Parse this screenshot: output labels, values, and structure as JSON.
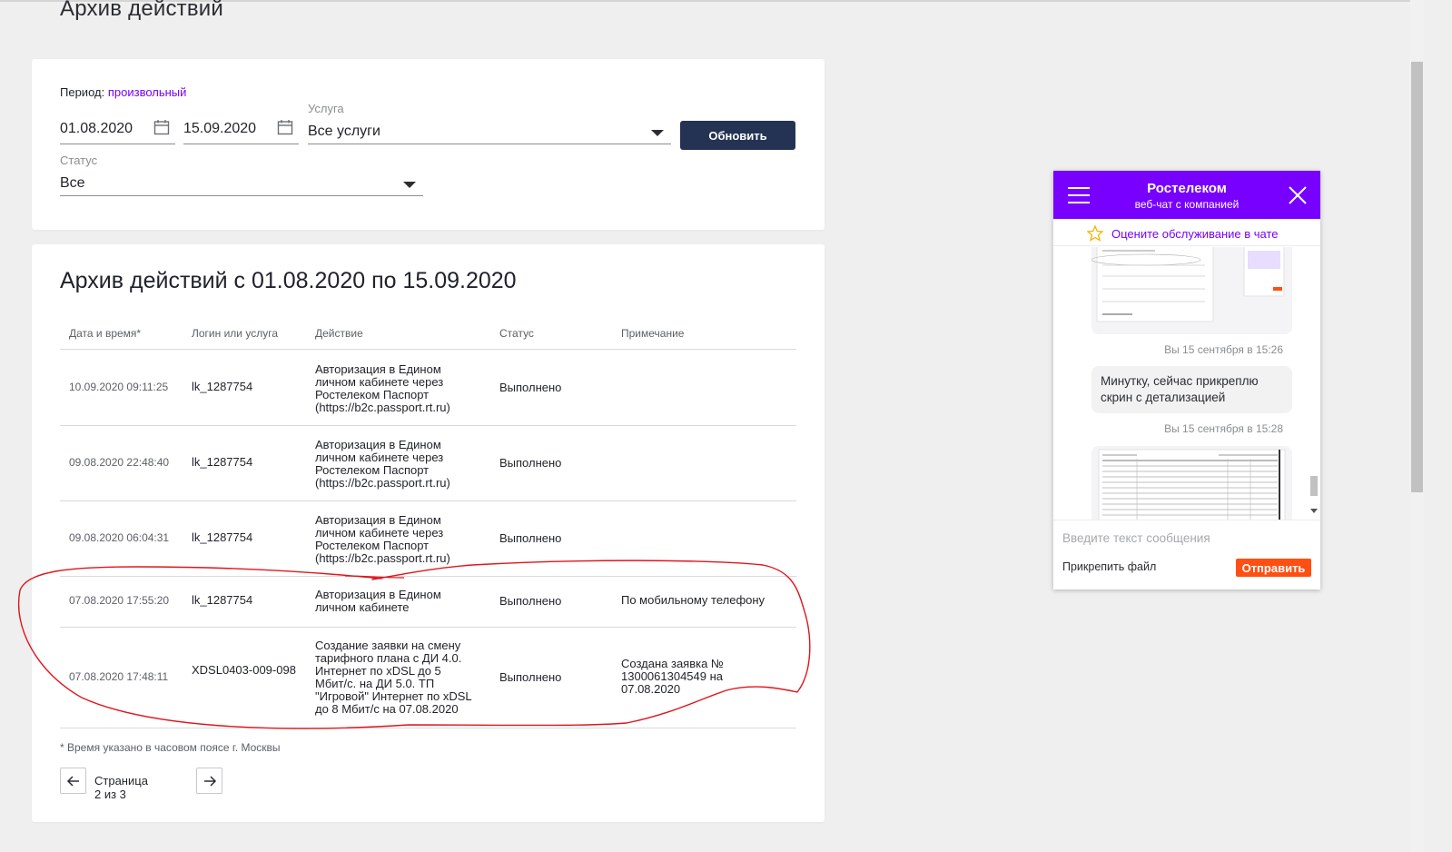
{
  "page": {
    "title": "Архив действий"
  },
  "filter": {
    "period_label": "Период:",
    "period_value": "произвольный",
    "date_from": "01.08.2020",
    "date_to": "15.09.2020",
    "service_label": "Услуга",
    "service_value": "Все услуги",
    "status_label": "Статус",
    "status_value": "Все",
    "update_button": "Обновить"
  },
  "archive": {
    "title": "Архив действий с 01.08.2020 по 15.09.2020",
    "columns": [
      "Дата и время*",
      "Логин или услуга",
      "Действие",
      "Статус",
      "Примечание"
    ],
    "rows": [
      {
        "datetime": "10.09.2020 09:11:25",
        "login": "lk_1287754",
        "action": [
          "Авторизация в Едином",
          "личном кабинете через",
          "Ростелеком Паспорт",
          "(https://b2c.passport.rt.ru)"
        ],
        "status": "Выполнено",
        "note": []
      },
      {
        "datetime": "09.08.2020 22:48:40",
        "login": "lk_1287754",
        "action": [
          "Авторизация в Едином",
          "личном кабинете через",
          "Ростелеком Паспорт",
          "(https://b2c.passport.rt.ru)"
        ],
        "status": "Выполнено",
        "note": []
      },
      {
        "datetime": "09.08.2020 06:04:31",
        "login": "lk_1287754",
        "action": [
          "Авторизация в Едином",
          "личном кабинете через",
          "Ростелеком Паспорт",
          "(https://b2c.passport.rt.ru)"
        ],
        "status": "Выполнено",
        "note": []
      },
      {
        "datetime": "07.08.2020 17:55:20",
        "login": "lk_1287754",
        "action": [
          "Авторизация в Едином",
          "личном кабинете"
        ],
        "status": "Выполнено",
        "note": [
          "По мобильному телефону"
        ]
      },
      {
        "datetime": "07.08.2020 17:48:11",
        "login": "XDSL0403-009-098",
        "action": [
          "Создание заявки на смену",
          "тарифного плана с ДИ 4.0.",
          "Интернет по xDSL до 5",
          "Мбит/с. на ДИ 5.0. ТП",
          "\"Игровой\" Интернет по xDSL",
          "до 8 Мбит/с на 07.08.2020"
        ],
        "status": "Выполнено",
        "note": [
          "Создана заявка №",
          "1300061304549 на",
          "07.08.2020"
        ]
      }
    ],
    "footnote": "* Время указано в часовом поясе г. Москвы",
    "pagination": "Страница 2 из 3"
  },
  "chat": {
    "title": "Ростелеком",
    "subtitle": "веб-чат с компанией",
    "rate_text": "Оцените обслуживание в чате",
    "messages": [
      {
        "type": "image",
        "time": "Вы 15 сентября в 15:26"
      },
      {
        "type": "text",
        "text": "Минутку, сейчас прикреплю скрин с детализацией",
        "time": "Вы 15 сентября в 15:28"
      },
      {
        "type": "image",
        "time": ""
      }
    ],
    "input_placeholder": "Введите текст сообщения",
    "attach_label": "Прикрепить файл",
    "send_label": "Отправить"
  },
  "colors": {
    "brand_purple": "#7700ff",
    "button_navy": "#243353",
    "send_orange": "#ff4f12",
    "annotation_red": "#e0151c"
  }
}
